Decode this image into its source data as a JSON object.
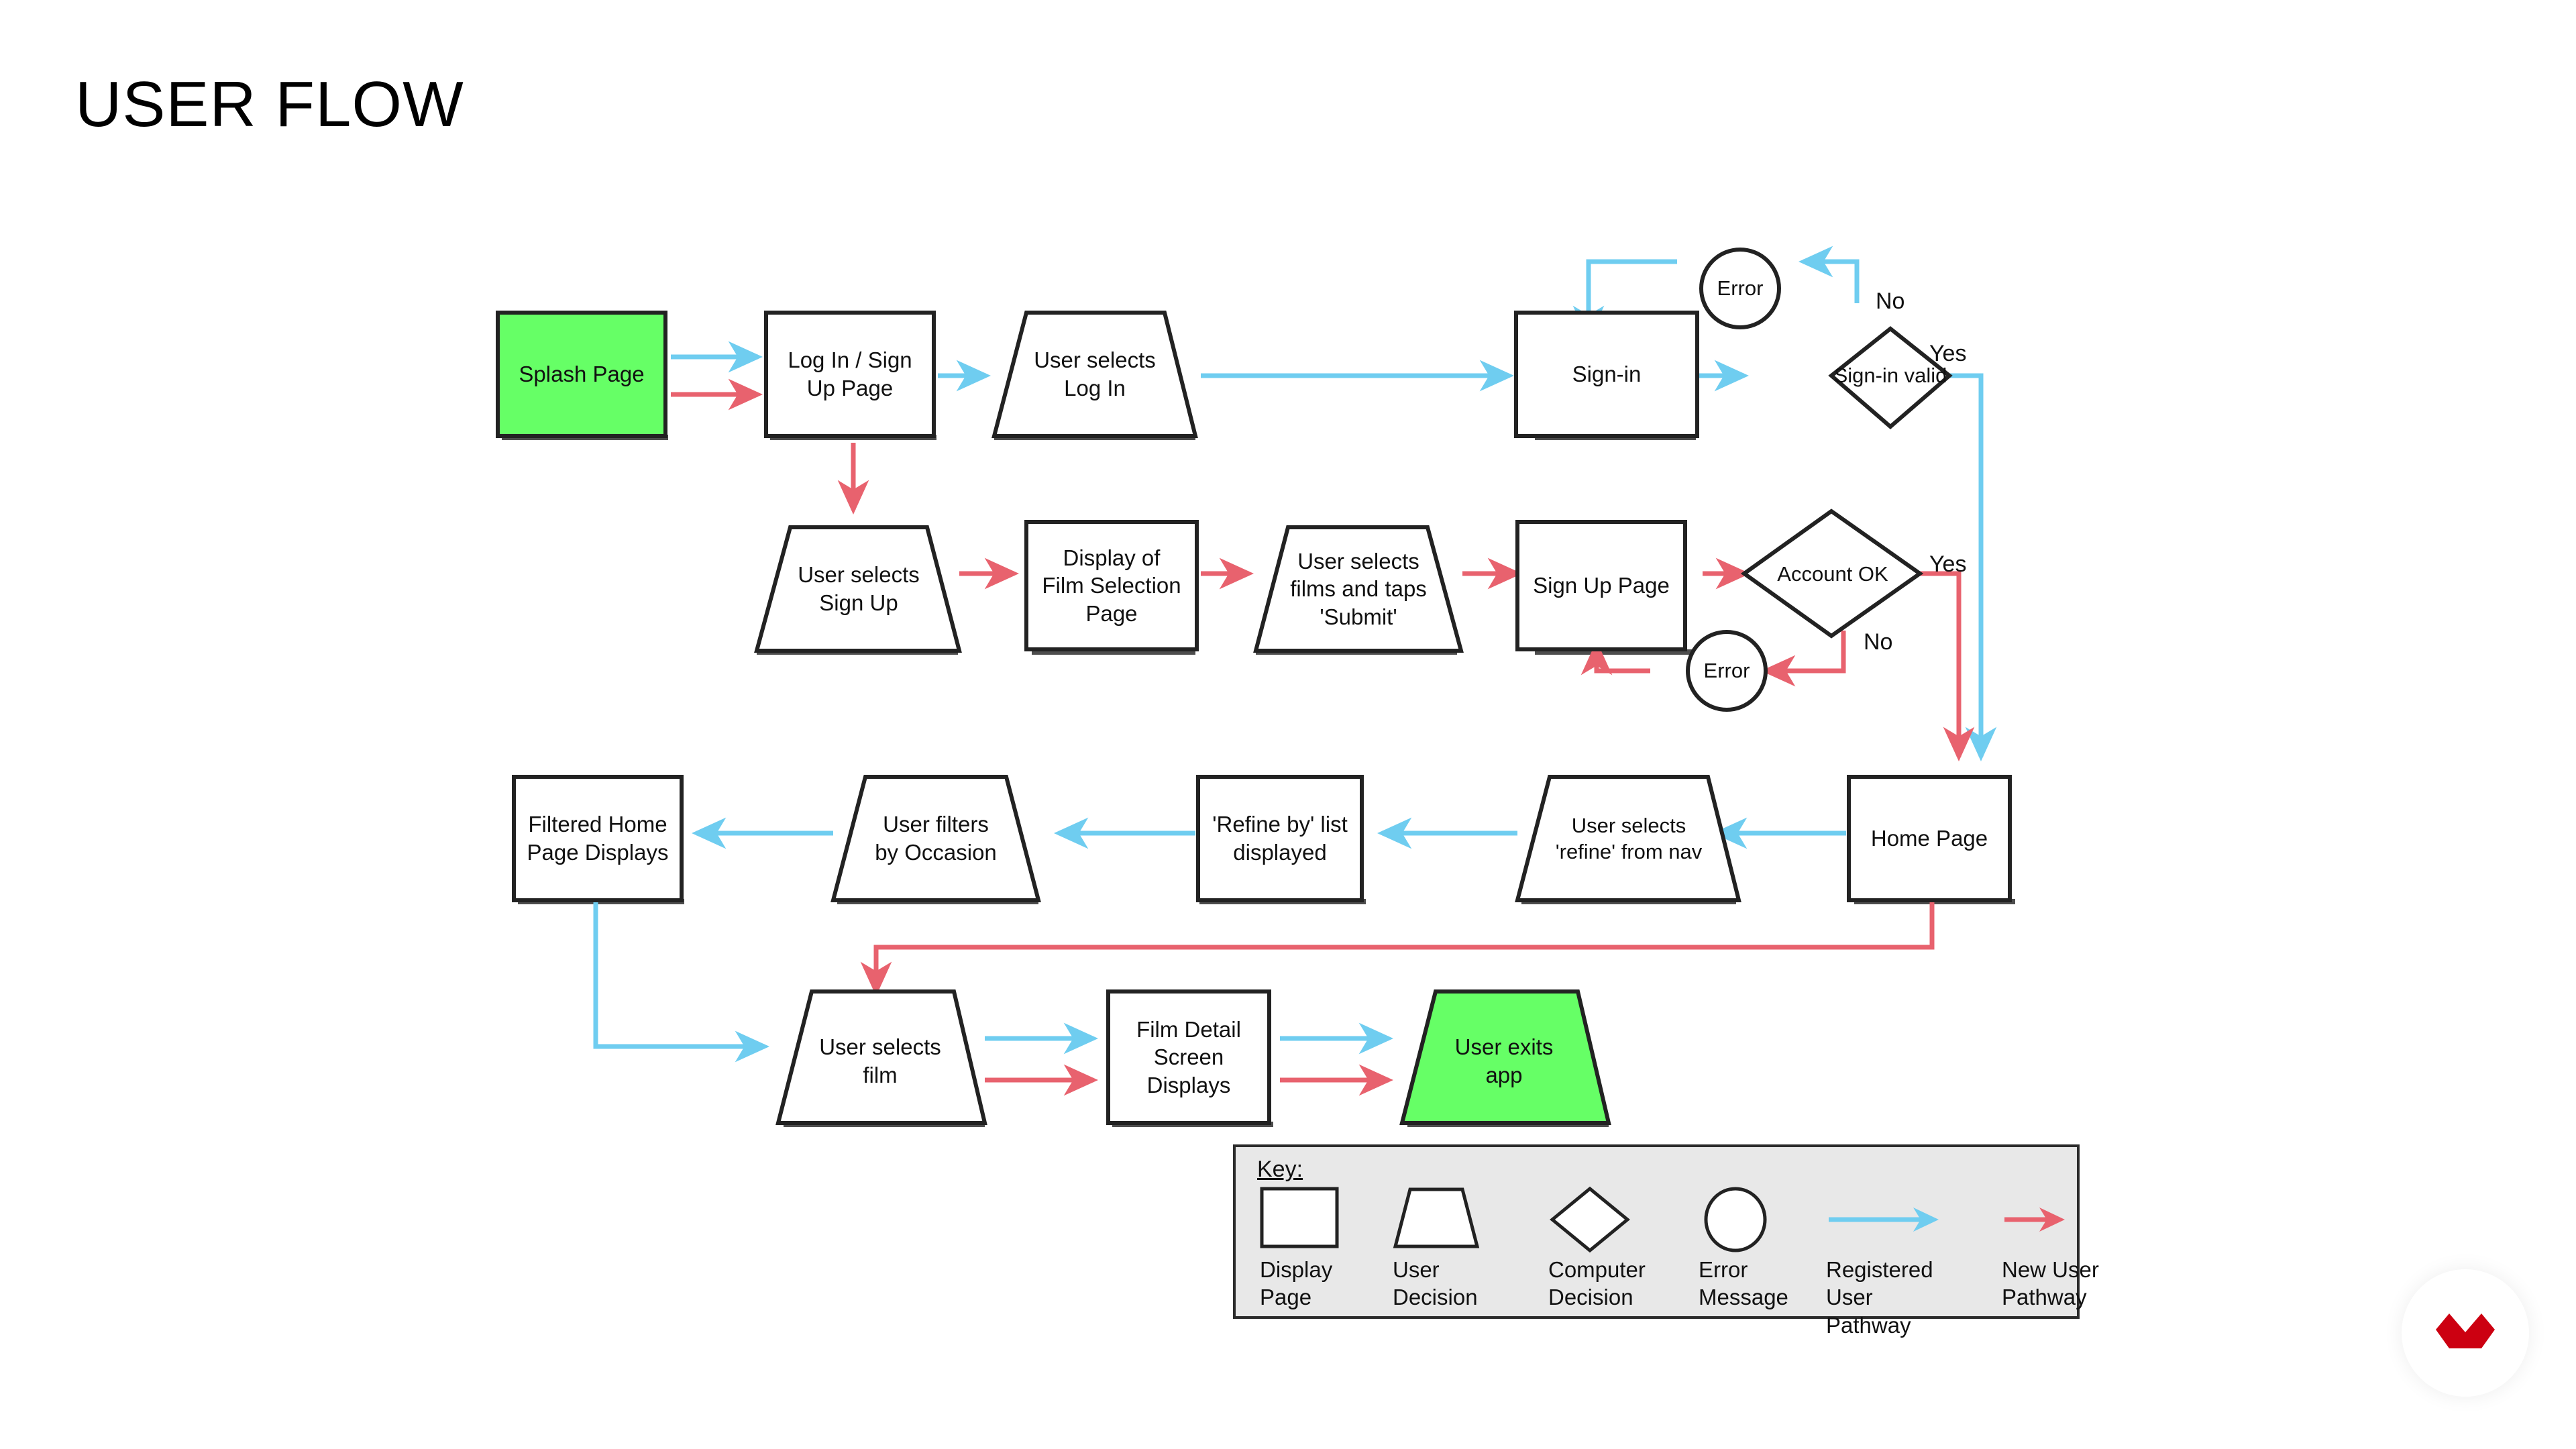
{
  "page": {
    "title": "USER FLOW",
    "background_color": "#ffffff"
  },
  "colors": {
    "registered_user_pathway": "#6FCDF0",
    "new_user_pathway": "#E8626E",
    "node_stroke": "#222222",
    "highlight_fill": "#66FF66",
    "key_background": "#E8E8E8",
    "logo_red": "#CC0011"
  },
  "nodes": [
    {
      "id": "splash-page",
      "label": "Splash Page",
      "shape": "rect",
      "fill": "#66FF66"
    },
    {
      "id": "login-signup-page",
      "label": "Log In / Sign\nUp Page",
      "shape": "rect",
      "fill": "#ffffff"
    },
    {
      "id": "user-selects-login",
      "label": "User selects\nLog In",
      "shape": "trapezoid",
      "fill": "#ffffff"
    },
    {
      "id": "sign-in",
      "label": "Sign-in",
      "shape": "rect",
      "fill": "#ffffff"
    },
    {
      "id": "error-signin",
      "label": "Error",
      "shape": "circle",
      "fill": "#ffffff"
    },
    {
      "id": "sign-in-valid",
      "label": "Sign-in valid",
      "shape": "diamond",
      "fill": "#ffffff"
    },
    {
      "id": "user-selects-signup",
      "label": "User selects\nSign Up",
      "shape": "trapezoid",
      "fill": "#ffffff"
    },
    {
      "id": "film-selection-page",
      "label": "Display of\nFilm Selection\nPage",
      "shape": "rect",
      "fill": "#ffffff"
    },
    {
      "id": "user-selects-films",
      "label": "User selects\nfilms and taps\n'Submit'",
      "shape": "trapezoid",
      "fill": "#ffffff"
    },
    {
      "id": "sign-up-page",
      "label": "Sign Up Page",
      "shape": "rect",
      "fill": "#ffffff"
    },
    {
      "id": "account-ok",
      "label": "Account OK",
      "shape": "diamond",
      "fill": "#ffffff"
    },
    {
      "id": "error-signup",
      "label": "Error",
      "shape": "circle",
      "fill": "#ffffff"
    },
    {
      "id": "home-page",
      "label": "Home Page",
      "shape": "rect",
      "fill": "#ffffff"
    },
    {
      "id": "user-selects-refine",
      "label": "User selects\n'refine' from nav",
      "shape": "trapezoid",
      "fill": "#ffffff"
    },
    {
      "id": "refine-by-list",
      "label": "'Refine by' list\ndisplayed",
      "shape": "rect",
      "fill": "#ffffff"
    },
    {
      "id": "user-filters",
      "label": "User filters\nby Occasion",
      "shape": "trapezoid",
      "fill": "#ffffff"
    },
    {
      "id": "filtered-home-page",
      "label": "Filtered Home\nPage Displays",
      "shape": "rect",
      "fill": "#ffffff"
    },
    {
      "id": "user-selects-film",
      "label": "User selects\nfilm",
      "shape": "trapezoid",
      "fill": "#ffffff"
    },
    {
      "id": "film-detail-screen",
      "label": "Film Detail\nScreen\nDisplays",
      "shape": "rect",
      "fill": "#ffffff"
    },
    {
      "id": "user-exits-app",
      "label": "User exits\napp",
      "shape": "trapezoid",
      "fill": "#66FF66"
    }
  ],
  "edge_labels": [
    {
      "id": "signin-no",
      "text": "No",
      "pathway": "registered"
    },
    {
      "id": "signin-yes",
      "text": "Yes",
      "pathway": "registered"
    },
    {
      "id": "account-yes",
      "text": "Yes",
      "pathway": "new"
    },
    {
      "id": "account-no",
      "text": "No",
      "pathway": "new"
    }
  ],
  "key": {
    "title": "Key:",
    "items": [
      {
        "id": "display-page",
        "glyph": "rect-icon",
        "caption": "Display\nPage"
      },
      {
        "id": "user-decision",
        "glyph": "trapezoid-icon",
        "caption": "User\nDecision"
      },
      {
        "id": "computer-decision",
        "glyph": "diamond-icon",
        "caption": "Computer\nDecision"
      },
      {
        "id": "error-message",
        "glyph": "circle-icon",
        "caption": "Error\nMessage"
      },
      {
        "id": "registered-user-pathway",
        "glyph": "blue-arrow-icon",
        "caption": "Registered User\nPathway"
      },
      {
        "id": "new-user-pathway",
        "glyph": "red-arrow-icon",
        "caption": "New User\nPathway"
      }
    ]
  },
  "logo": {
    "name": "brand-logo"
  }
}
